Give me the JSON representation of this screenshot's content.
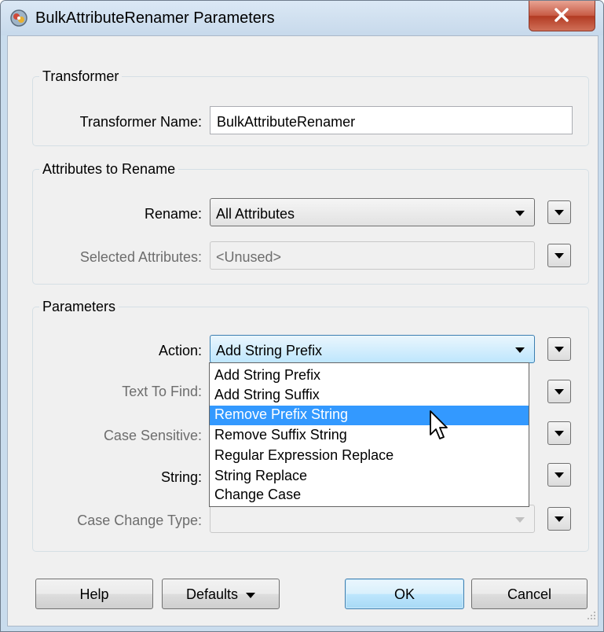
{
  "window": {
    "title": "BulkAttributeRenamer Parameters"
  },
  "transformer_group": {
    "title": "Transformer",
    "name_label": "Transformer Name:",
    "name_value": "BulkAttributeRenamer"
  },
  "attributes_group": {
    "title": "Attributes to Rename",
    "rename_label": "Rename:",
    "rename_value": "All Attributes",
    "selected_label": "Selected Attributes:",
    "selected_value": "<Unused>"
  },
  "parameters_group": {
    "title": "Parameters",
    "action_label": "Action:",
    "action_value": "Add String Prefix",
    "text_to_find_label": "Text To Find:",
    "case_sensitive_label": "Case Sensitive:",
    "string_label": "String:",
    "case_change_type_label": "Case Change Type:"
  },
  "action_dropdown": {
    "options": [
      "Add String Prefix",
      "Add String Suffix",
      "Remove Prefix String",
      "Remove Suffix String",
      "Regular Expression Replace",
      "String Replace",
      "Change Case"
    ],
    "highlighted": "Remove Prefix String"
  },
  "buttons": {
    "help": "Help",
    "defaults": "Defaults",
    "ok": "OK",
    "cancel": "Cancel"
  },
  "icons": {
    "app": "fme-transformer-icon",
    "close": "close-icon",
    "menu": "triangle-down-icon"
  },
  "colors": {
    "selection": "#3399ff",
    "close_button": "#c75a44",
    "default_button_border": "#3c7fb1"
  }
}
